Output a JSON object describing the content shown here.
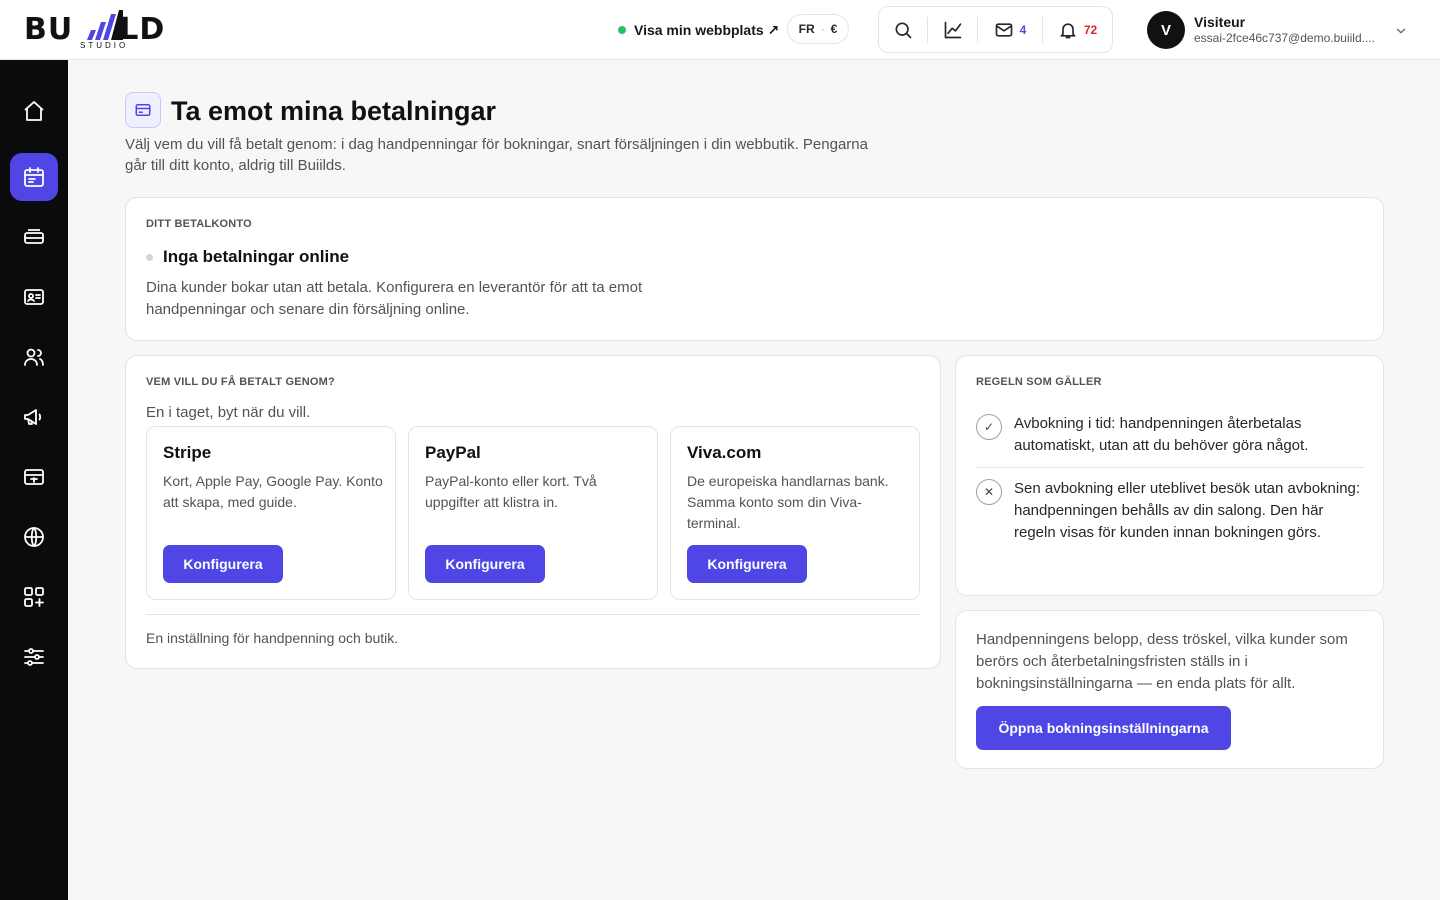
{
  "brand": {
    "logo_text_left": "BU",
    "logo_text_right": "LD",
    "logo_sub": "STUDIO",
    "accent": "#4f46e5"
  },
  "topbar": {
    "visit_label": "Visa min webbplats ↗",
    "locale": "FR",
    "currency": "€",
    "mail_count": "4",
    "notif_count": "72",
    "user_initial": "V",
    "user_name": "Visiteur",
    "user_email": "essai-2fce46c737@demo.buiild...."
  },
  "sidebar": {
    "items": [
      {
        "icon": "home-icon",
        "active": false
      },
      {
        "icon": "calendar-icon",
        "active": true
      },
      {
        "icon": "stack-icon",
        "active": false
      },
      {
        "icon": "contact-card-icon",
        "active": false
      },
      {
        "icon": "users-icon",
        "active": false
      },
      {
        "icon": "megaphone-icon",
        "active": false
      },
      {
        "icon": "register-icon",
        "active": false
      },
      {
        "icon": "globe-icon",
        "active": false
      },
      {
        "icon": "apps-add-icon",
        "active": false
      },
      {
        "icon": "sliders-icon",
        "active": false
      }
    ]
  },
  "page": {
    "title": "Ta emot mina betalningar",
    "description": "Välj vem du vill få betalt genom: i dag handpenningar för bokningar, snart försäljningen i din webbutik. Pengarna går till ditt konto, aldrig till Buiilds."
  },
  "account": {
    "eyebrow": "DITT BETALKONTO",
    "status": "Inga betalningar online",
    "description": "Dina kunder bokar utan att betala. Konfigurera en leverantör för att ta emot handpenningar och senare din försäljning online."
  },
  "providers_section": {
    "eyebrow": "VEM VILL DU FÅ BETALT GENOM?",
    "lead": "En i taget, byt när du vill.",
    "providers": [
      {
        "name": "Stripe",
        "description": "Kort, Apple Pay, Google Pay. Konto att skapa, med guide.",
        "button": "Konfigurera"
      },
      {
        "name": "PayPal",
        "description": "PayPal-konto eller kort. Två uppgifter att klistra in.",
        "button": "Konfigurera"
      },
      {
        "name": "Viva.com",
        "description": "De europeiska handlarnas bank. Samma konto som din Viva-terminal.",
        "button": "Konfigurera"
      }
    ],
    "footnote": "En inställning för handpenning och butik."
  },
  "rules": {
    "eyebrow": "REGELN SOM GÄLLER",
    "items": [
      {
        "icon": "check-icon",
        "symbol": "✓",
        "text": "Avbokning i tid: handpenningen återbetalas automatiskt, utan att du behöver göra något."
      },
      {
        "icon": "cross-icon",
        "symbol": "✕",
        "text": "Sen avbokning eller uteblivet besök utan avbokning: handpenningen behålls av din salong. Den här regeln visas för kunden innan bokningen görs."
      }
    ]
  },
  "settings": {
    "text": "Handpenningens belopp, dess tröskel, vilka kunder som berörs och återbetalningsfristen ställs in i bokningsinställningarna — en enda plats för allt.",
    "button": "Öppna bokningsinställningarna"
  }
}
